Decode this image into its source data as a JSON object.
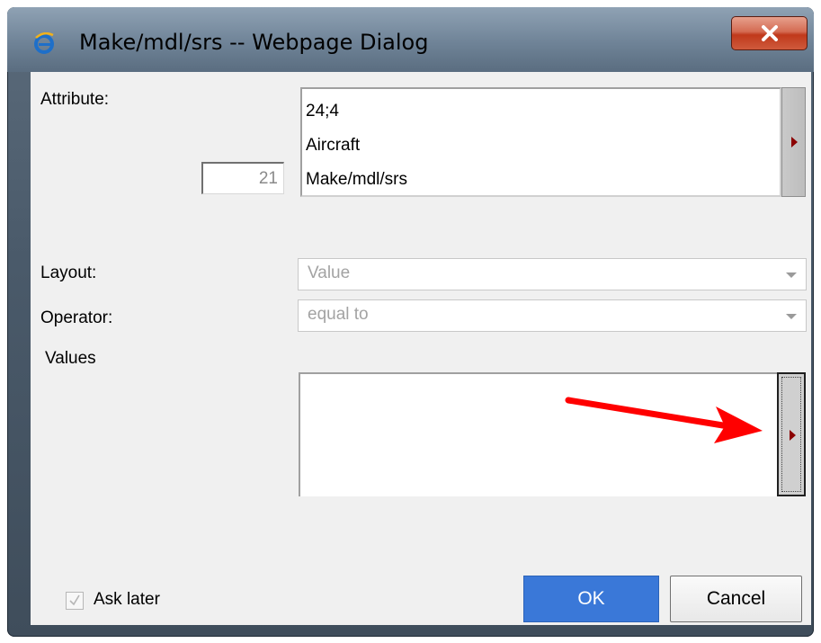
{
  "window": {
    "title": "Make/mdl/srs -- Webpage Dialog",
    "close_glyph": "X"
  },
  "attribute": {
    "label": "Attribute:",
    "number": "21",
    "lines": [
      "24;4",
      "Aircraft",
      "Make/mdl/srs"
    ]
  },
  "layout": {
    "label": "Layout:",
    "value": "Value"
  },
  "operator": {
    "label": "Operator:",
    "value": "equal to"
  },
  "values": {
    "label": "Values"
  },
  "ask_later": {
    "label": "Ask later",
    "checked": true
  },
  "buttons": {
    "ok": "OK",
    "cancel": "Cancel"
  },
  "colors": {
    "ok_button": "#3a78d8",
    "close_button": "#c0391b",
    "annotation_arrow": "#ff0000",
    "picker_triangle": "#8b0000"
  },
  "icons": {
    "window_icon": "internet-explorer-icon",
    "close": "close-icon",
    "picker": "triangle-right-icon",
    "dropdown": "chevron-down-icon",
    "annotation": "red-arrow-icon"
  }
}
